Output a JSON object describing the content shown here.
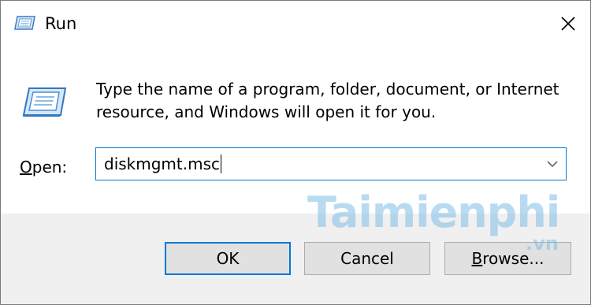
{
  "window": {
    "title": "Run",
    "close_icon": "close-icon",
    "title_icon": "run-app-icon"
  },
  "content": {
    "icon": "run-app-icon",
    "description": "Type the name of a program, folder, document, or Internet resource, and Windows will open it for you.",
    "open_label_accel": "O",
    "open_label_rest": "pen:",
    "open_value": "diskmgmt.msc",
    "dropdown_icon": "chevron-down-icon"
  },
  "buttons": {
    "ok_label": "OK",
    "cancel_label": "Cancel",
    "browse_accel": "B",
    "browse_rest": "rowse..."
  },
  "watermark": {
    "main": "Taimienphi",
    "sub": ".vn"
  },
  "colors": {
    "accent": "#0078d7",
    "footer_bg": "#f0f0f0",
    "button_bg": "#e1e1e1",
    "watermark": "#80bee6"
  }
}
